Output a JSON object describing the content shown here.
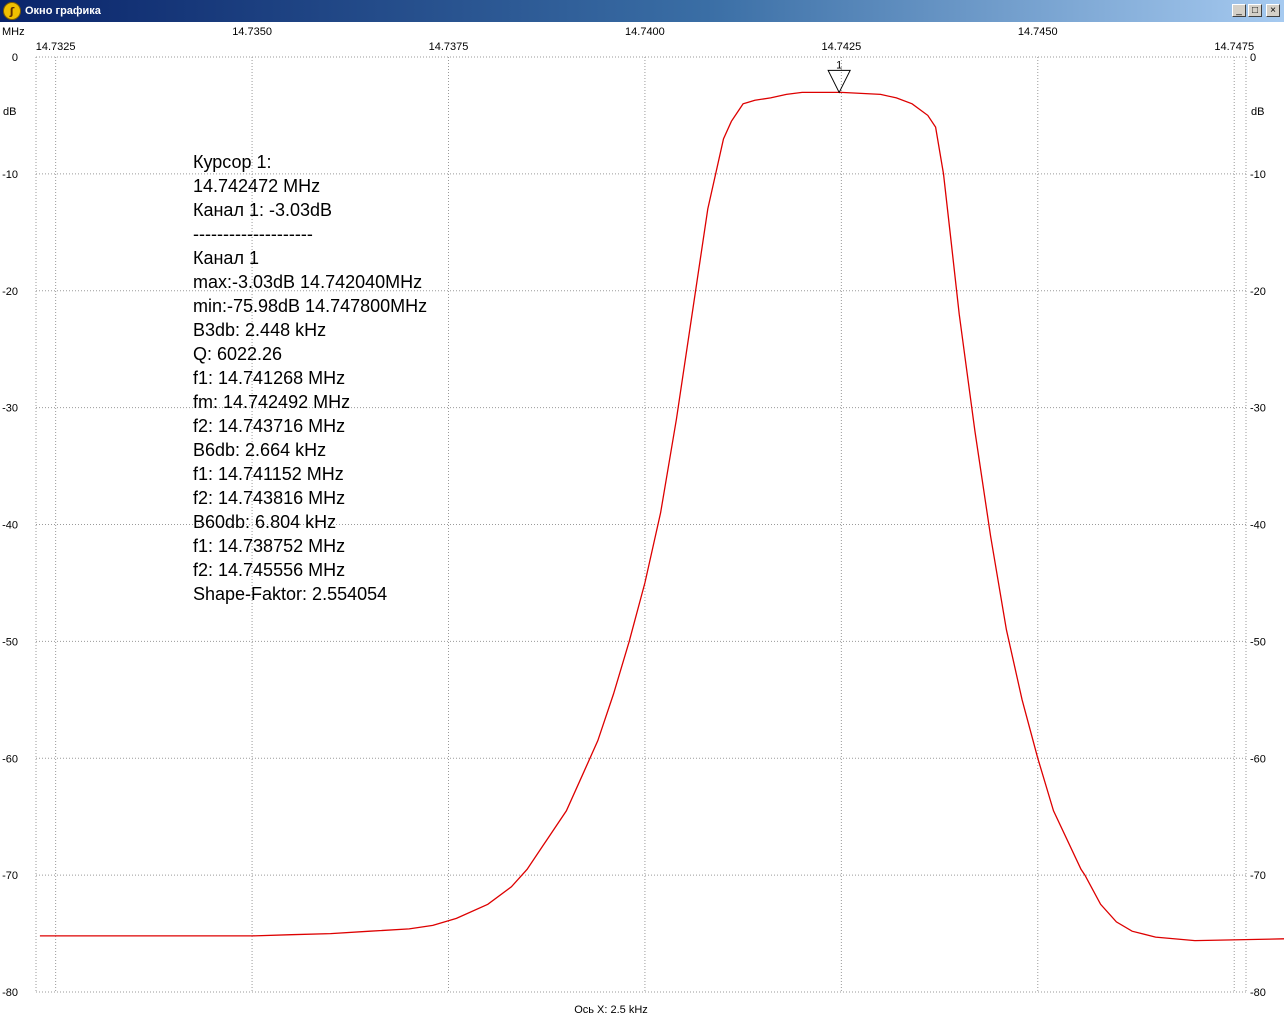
{
  "window": {
    "title": "Окно графика",
    "minimize_glyph": "_",
    "maximize_glyph": "□",
    "close_glyph": "×"
  },
  "chart_data": {
    "type": "line",
    "x_unit_label": "MHz",
    "y_unit_label": "dB",
    "x_axis_caption": "Ось X: 2.5 kHz",
    "xlim": [
      14.73225,
      14.74765
    ],
    "ylim": [
      -80,
      0
    ],
    "x_ticks_upper": [
      14.735,
      14.74,
      14.745
    ],
    "x_ticks_lower": [
      14.7325,
      14.7375,
      14.7425,
      14.7475
    ],
    "x_tick_labels_upper": [
      "14.7350",
      "14.7400",
      "14.7450"
    ],
    "x_tick_labels_lower": [
      "14.7325",
      "14.7375",
      "14.7425",
      "14.7475"
    ],
    "y_ticks": [
      0,
      -10,
      -20,
      -30,
      -40,
      -50,
      -60,
      -70,
      -80
    ],
    "y_tick_labels": [
      "0",
      "-10",
      "-20",
      "-30",
      "-40",
      "-50",
      "-60",
      "-70",
      "-80"
    ],
    "grid": true,
    "line_color": "#dd0000",
    "marker": {
      "label": "1",
      "x": 14.742472,
      "y": -3.03
    },
    "series": [
      {
        "x": [
          14.7323,
          14.733,
          14.734,
          14.735,
          14.7355,
          14.736,
          14.7365,
          14.737,
          14.7373,
          14.7376,
          14.738,
          14.7383,
          14.7385,
          14.7387,
          14.73875,
          14.739,
          14.7392,
          14.7394,
          14.7396,
          14.7398,
          14.74,
          14.7402,
          14.7404,
          14.7406,
          14.7408,
          14.741,
          14.7411,
          14.7412,
          14.74125,
          14.7413,
          14.7414,
          14.7416,
          14.7418,
          14.742,
          14.7425,
          14.743,
          14.7432,
          14.7434,
          14.7436,
          14.7437,
          14.7438,
          14.7439,
          14.744,
          14.7442,
          14.7444,
          14.7446,
          14.7448,
          14.745,
          14.7452,
          14.74555,
          14.7456,
          14.7458,
          14.746,
          14.7462,
          14.7465,
          14.747,
          14.7478,
          14.7485
        ],
        "y": [
          -75.2,
          -75.2,
          -75.2,
          -75.2,
          -75.1,
          -75.0,
          -74.8,
          -74.6,
          -74.3,
          -73.7,
          -72.5,
          -71.0,
          -69.5,
          -67.5,
          -67.0,
          -64.5,
          -61.5,
          -58.5,
          -54.5,
          -50.0,
          -45.0,
          -39.0,
          -31.0,
          -22.0,
          -13.0,
          -7.0,
          -5.5,
          -4.5,
          -4.0,
          -3.9,
          -3.7,
          -3.5,
          -3.2,
          -3.03,
          -3.03,
          -3.2,
          -3.5,
          -4.0,
          -5.0,
          -6.0,
          -10.0,
          -16.0,
          -22.0,
          -32.0,
          -41.0,
          -49.0,
          -55.0,
          -60.0,
          -64.5,
          -69.5,
          -70.0,
          -72.5,
          -74.0,
          -74.8,
          -75.3,
          -75.6,
          -75.5,
          -75.4
        ]
      }
    ],
    "info_lines": [
      "Курсор 1:",
      "14.742472 MHz",
      "Канал 1:  -3.03dB",
      "--------------------",
      "Канал 1",
      "max:-3.03dB 14.742040MHz",
      "min:-75.98dB 14.747800MHz",
      "B3db: 2.448 kHz",
      "Q: 6022.26",
      "f1: 14.741268 MHz",
      "fm: 14.742492 MHz",
      "f2: 14.743716 MHz",
      "B6db: 2.664 kHz",
      "f1: 14.741152 MHz",
      "f2: 14.743816 MHz",
      "B60db: 6.804 kHz",
      "f1: 14.738752 MHz",
      "f2: 14.745556 MHz",
      "Shape-Faktor: 2.554054"
    ]
  }
}
